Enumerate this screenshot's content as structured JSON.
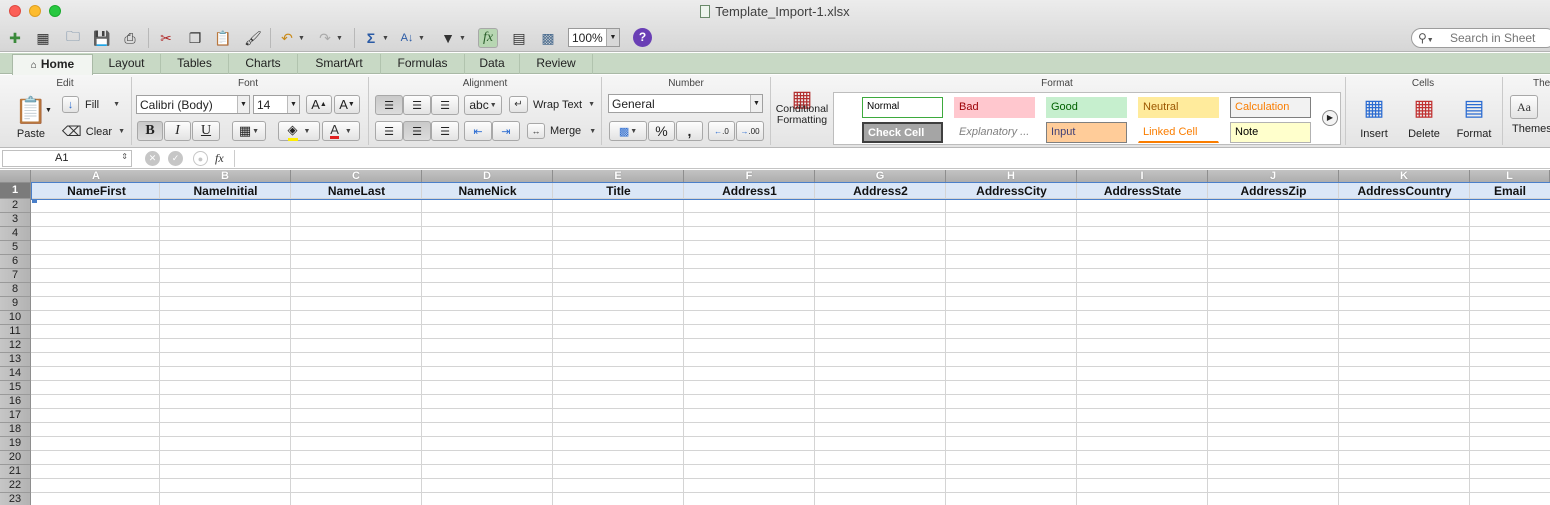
{
  "window": {
    "title": "Template_Import-1.xlsx"
  },
  "toolbar": {
    "zoom": "100%",
    "help_label": "?",
    "search_placeholder": "Search in Sheet",
    "fx_label": "fx"
  },
  "ribbon_tabs": [
    "Home",
    "Layout",
    "Tables",
    "Charts",
    "SmartArt",
    "Formulas",
    "Data",
    "Review"
  ],
  "ribbon": {
    "groups": {
      "edit": "Edit",
      "font": "Font",
      "alignment": "Alignment",
      "number": "Number",
      "format": "Format",
      "cells": "Cells",
      "themes": "The"
    },
    "edit": {
      "paste": "Paste",
      "fill": "Fill",
      "clear": "Clear"
    },
    "font": {
      "name": "Calibri (Body)",
      "size": "14",
      "bold": "B",
      "italic": "I",
      "underline": "U",
      "grow": "A",
      "shrink": "A",
      "font_color": "A"
    },
    "alignment": {
      "wrap_text": "Wrap Text",
      "merge": "Merge",
      "abc": "abc"
    },
    "number": {
      "format": "General",
      "percent": "%",
      "comma": ",",
      "inc_decimal": ".0",
      "dec_decimal": ".00"
    },
    "format": {
      "conditional_line1": "Conditional",
      "conditional_line2": "Formatting",
      "styles": [
        {
          "label": "Normal",
          "bg": "#ffffff",
          "fg": "#000000",
          "border": "#3daa3d"
        },
        {
          "label": "Bad",
          "bg": "#ffc7ce",
          "fg": "#9c0006",
          "border": "#ffc7ce"
        },
        {
          "label": "Good",
          "bg": "#c6efce",
          "fg": "#006100",
          "border": "#c6efce"
        },
        {
          "label": "Neutral",
          "bg": "#ffeb9c",
          "fg": "#9c5700",
          "border": "#ffeb9c"
        },
        {
          "label": "Calculation",
          "bg": "#f2f2f2",
          "fg": "#fa7d00",
          "border": "#7f7f7f"
        },
        {
          "label": "Check Cell",
          "bg": "#a5a5a5",
          "fg": "#ffffff",
          "border": "#3f3f3f"
        },
        {
          "label": "Explanatory ...",
          "bg": "#ffffff",
          "fg": "#7f7f7f",
          "border": "#ffffff"
        },
        {
          "label": "Input",
          "bg": "#ffcc99",
          "fg": "#3f3f76",
          "border": "#7f7f7f"
        },
        {
          "label": "Linked Cell",
          "bg": "#ffffff",
          "fg": "#fa7d00",
          "border": "#ffffff"
        },
        {
          "label": "Note",
          "bg": "#ffffcc",
          "fg": "#000000",
          "border": "#b2b2b2"
        }
      ]
    },
    "cells": {
      "insert": "Insert",
      "delete": "Delete",
      "format": "Format"
    },
    "themes": {
      "themes": "Themes",
      "sample": "Aa"
    }
  },
  "formula_bar": {
    "name_box": "A1",
    "formula": ""
  },
  "sheet": {
    "columns": [
      "A",
      "B",
      "C",
      "D",
      "E",
      "F",
      "G",
      "H",
      "I",
      "J",
      "K",
      "L"
    ],
    "headers": [
      "NameFirst",
      "NameInitial",
      "NameLast",
      "NameNick",
      "Title",
      "Address1",
      "Address2",
      "AddressCity",
      "AddressState",
      "AddressZip",
      "AddressCountry",
      "Email"
    ],
    "rows": [
      "1",
      "2",
      "3",
      "4",
      "5",
      "6",
      "7",
      "8",
      "9",
      "10",
      "11",
      "12",
      "13",
      "14",
      "15",
      "16",
      "17",
      "18",
      "19",
      "20",
      "21",
      "22",
      "23"
    ]
  }
}
